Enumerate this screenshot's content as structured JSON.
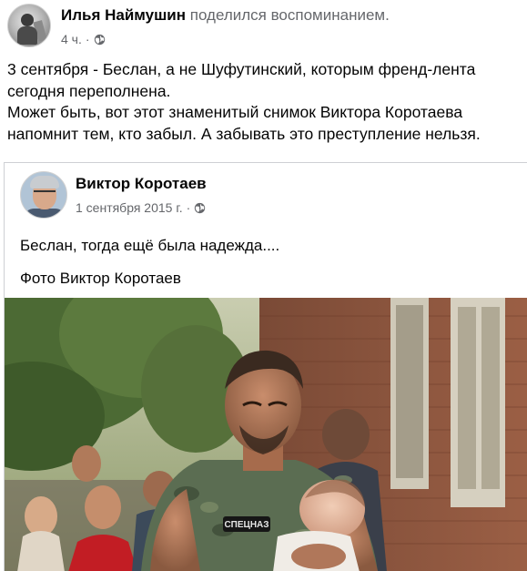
{
  "post": {
    "author": "Илья Наймушин",
    "action": "поделился воспоминанием.",
    "time": "4 ч.",
    "separator": "·",
    "privacy_icon": "globe-icon",
    "text_lines": [
      "3 сентября - Беслан, а не Шуфутинский, которым френд-лента",
      "сегодня переполнена.",
      "Может быть, вот этот знаменитый снимок Виктора Коротаева",
      "напомнит тем, кто забыл. А забывать это преступление нельзя."
    ]
  },
  "shared": {
    "author": "Виктор Коротаев",
    "date": "1 сентября 2015 г.",
    "separator": "·",
    "privacy_icon": "globe-icon",
    "text_lines": [
      "Беслан, тогда ещё была надежда....",
      "Фото Виктор Коротаев"
    ],
    "photo": {
      "patch_text": "СПЕЦНАЗ"
    }
  },
  "colors": {
    "text": "#050505",
    "secondary": "#65676b",
    "border": "#ced0d4"
  }
}
